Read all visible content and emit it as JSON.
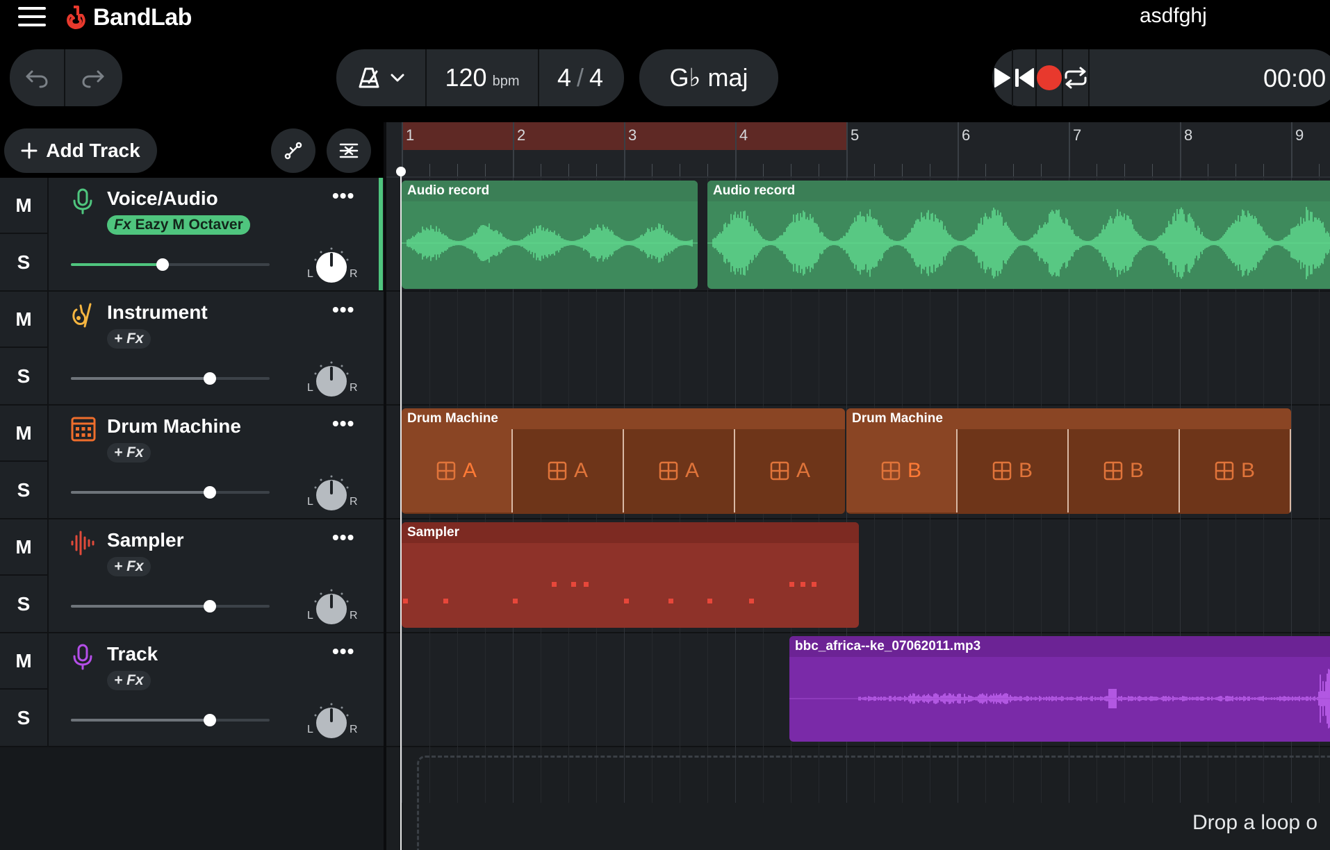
{
  "app": {
    "brand": "BandLab",
    "project_name": "asdfghj"
  },
  "toolbar": {
    "tempo_value": "120",
    "tempo_unit": "bpm",
    "time_sig_num": "4",
    "time_sig_sep": "/",
    "time_sig_den": "4",
    "key": "G♭ maj",
    "time_display": "00:00"
  },
  "controls": {
    "add_track_label": "Add Track"
  },
  "tracks": [
    {
      "mute": "M",
      "solo": "S",
      "name": "Voice/Audio",
      "fx_label": "Fx",
      "fx_name": "Eazy M Octaver",
      "volume": 0.46,
      "color": "#4fc57e"
    },
    {
      "mute": "M",
      "solo": "S",
      "name": "Instrument",
      "fx_label": "+ Fx",
      "volume": 0.7,
      "color": "#f5b540"
    },
    {
      "mute": "M",
      "solo": "S",
      "name": "Drum Machine",
      "fx_label": "+ Fx",
      "volume": 0.7,
      "color": "#ef6e2c"
    },
    {
      "mute": "M",
      "solo": "S",
      "name": "Sampler",
      "fx_label": "+ Fx",
      "volume": 0.7,
      "color": "#e04a3a"
    },
    {
      "mute": "M",
      "solo": "S",
      "name": "Track",
      "fx_label": "+ Fx",
      "volume": 0.7,
      "color": "#b44ee8"
    }
  ],
  "ruler": {
    "bars": [
      "1",
      "2",
      "3",
      "4",
      "5",
      "6",
      "7",
      "8",
      "9"
    ]
  },
  "clips": {
    "audio1": "Audio record",
    "audio2": "Audio record",
    "drum1": "Drum Machine",
    "drum2": "Drum Machine",
    "drum_pattern_a": "A",
    "drum_pattern_b": "B",
    "sampler": "Sampler",
    "mp3": "bbc_africa--ke_07062011.mp3"
  },
  "dropzone": {
    "text": "Drop a loop o"
  },
  "colors": {
    "green": "#4fc57e",
    "orange": "#ef6e2c",
    "red": "#e04a3a",
    "purple": "#b44ee8",
    "record": "#e8392d"
  }
}
